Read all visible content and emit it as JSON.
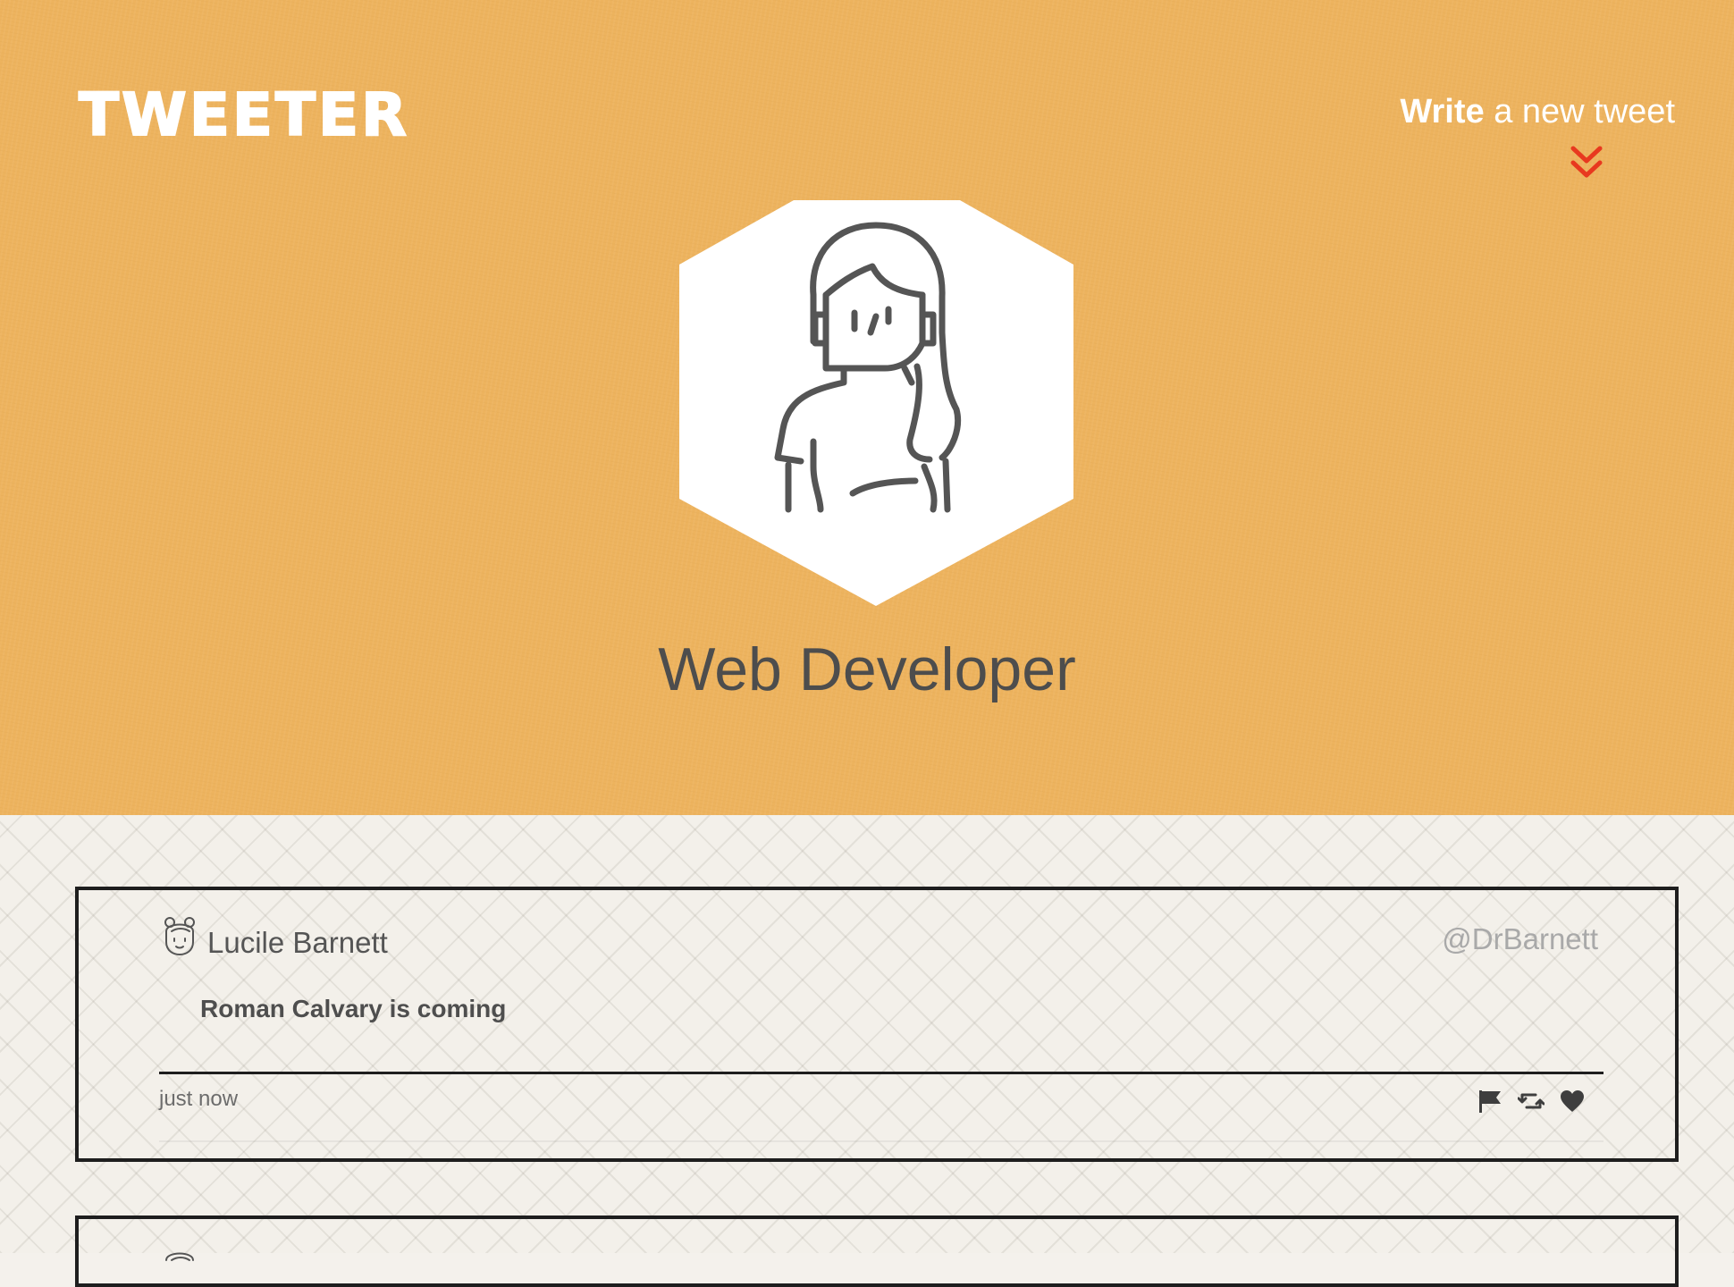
{
  "header": {
    "logo": "TWEETER",
    "compose": {
      "strong": "Write",
      "rest": " a new tweet"
    },
    "profile_name": "Web Developer",
    "background_color": "#edb35e",
    "accent_color": "#e8391f"
  },
  "tweets": [
    {
      "name": "Lucile Barnett",
      "handle": "@DrBarnett",
      "text": "Roman Calvary is coming",
      "time": "just now",
      "avatar_icon": "user-avatar-icon",
      "actions": [
        "flag-icon",
        "retweet-icon",
        "heart-icon"
      ]
    },
    {
      "avatar_icon": "user-avatar-icon"
    }
  ]
}
